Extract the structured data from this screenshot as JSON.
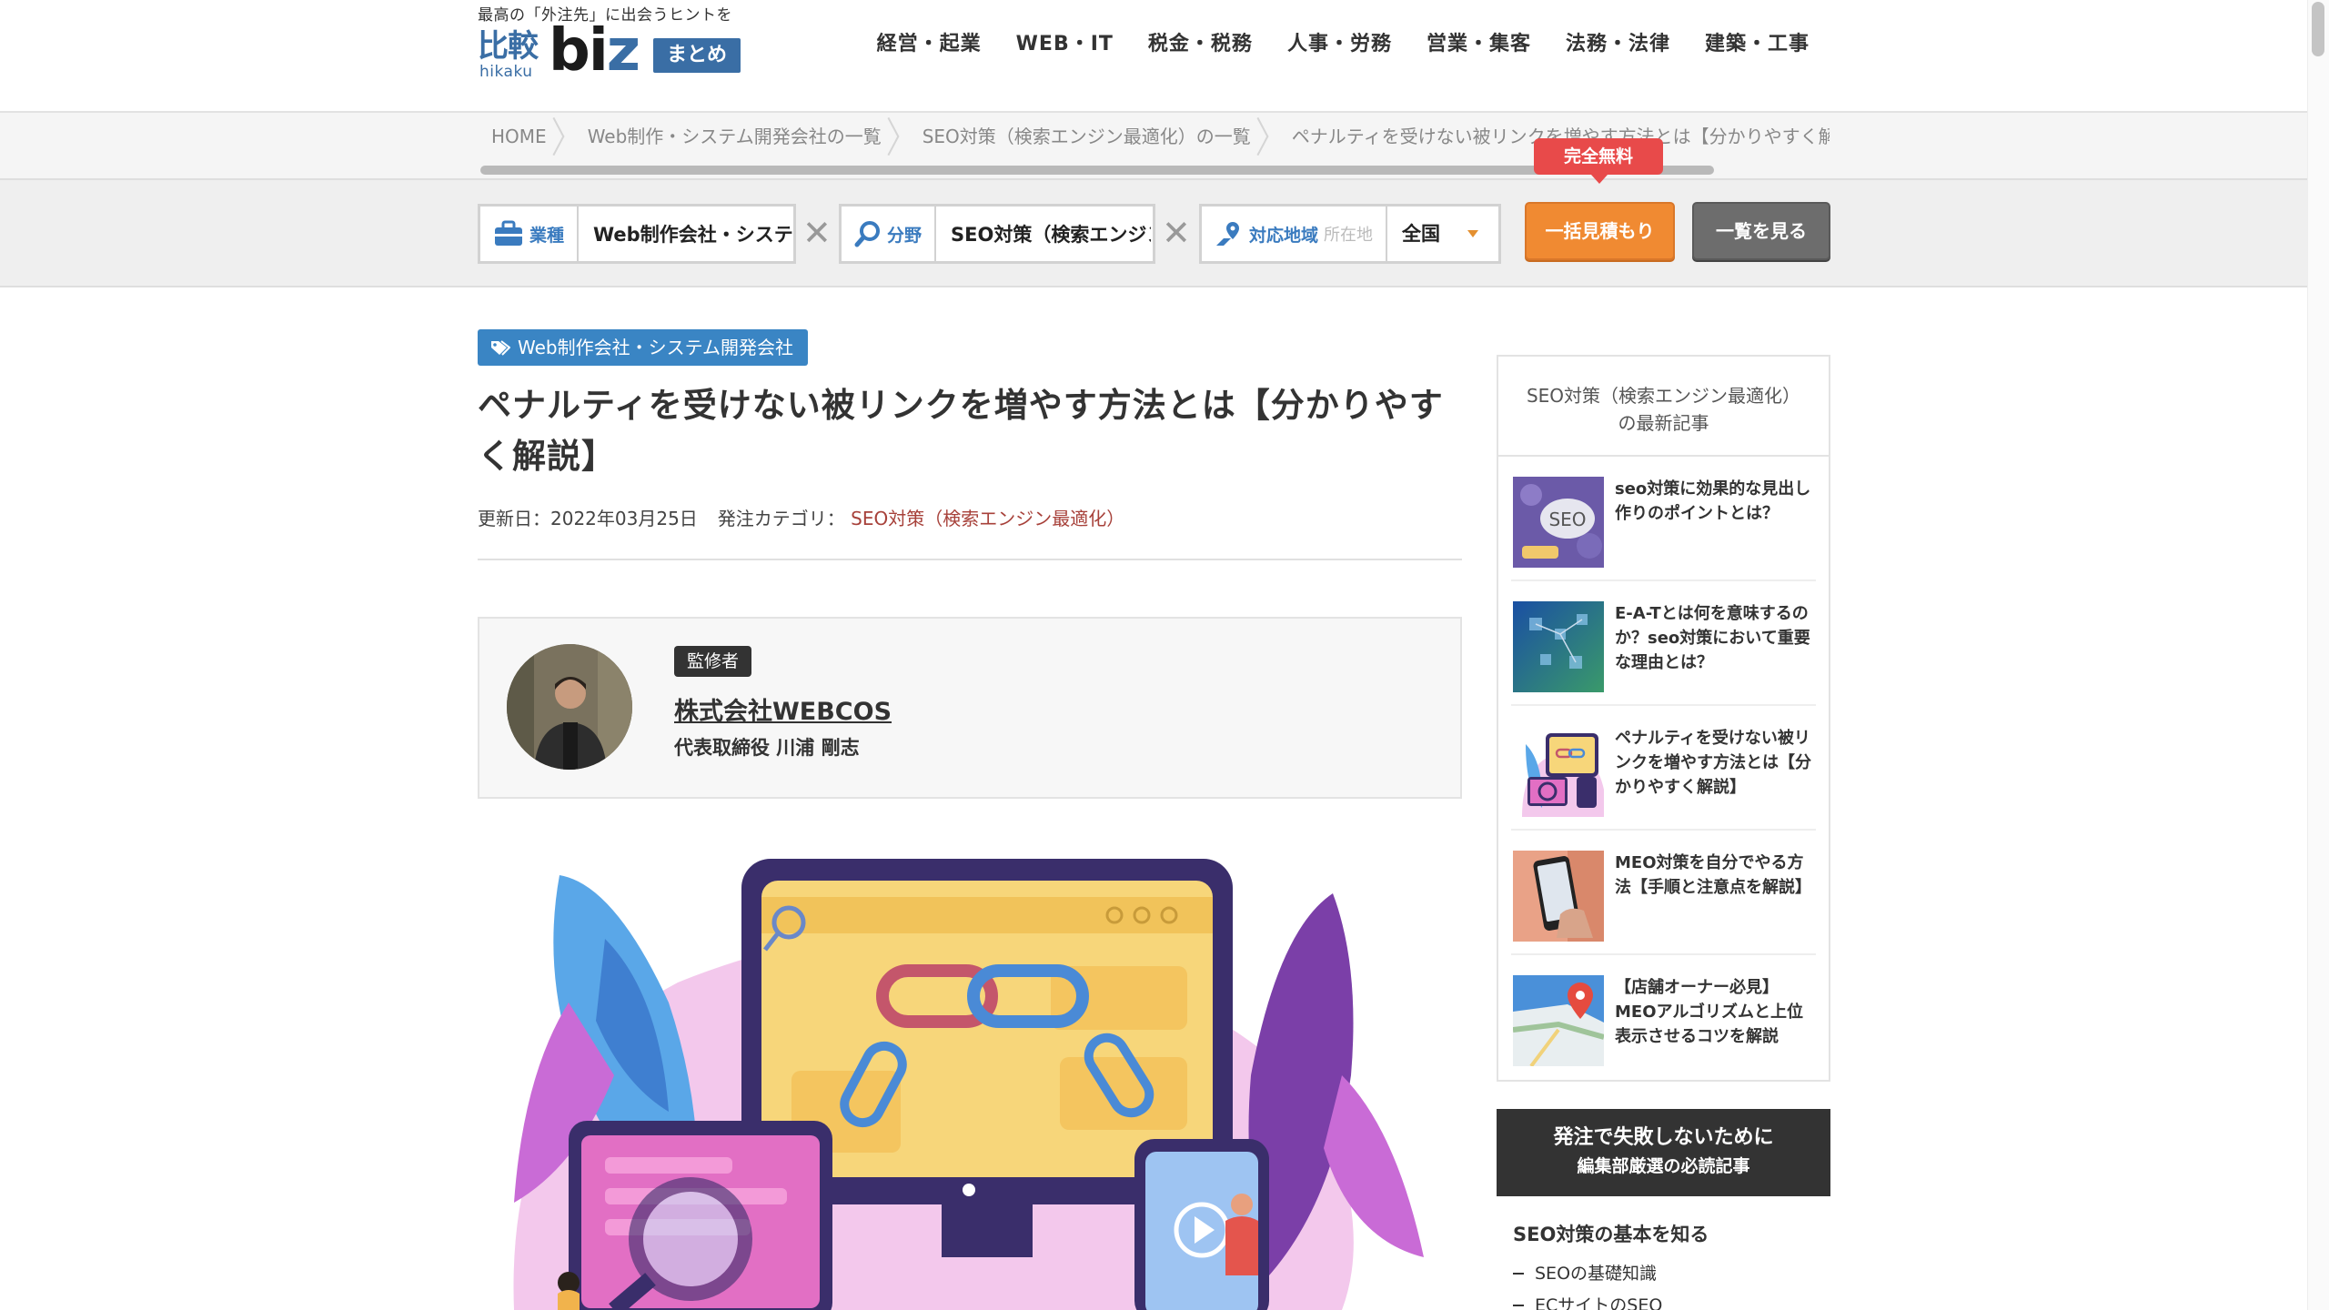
{
  "header": {
    "tagline": "最高の「外注先」に出会うヒントを",
    "logo": {
      "kanji": "比較",
      "roman": "hikaku",
      "biz": "biz",
      "matome": "まとめ"
    },
    "nav": [
      "経営・起業",
      "WEB・IT",
      "税金・税務",
      "人事・労務",
      "営業・集客",
      "法務・法律",
      "建築・工事"
    ]
  },
  "breadcrumb": [
    "HOME",
    "Web制作・システム開発会社の一覧",
    "SEO対策（検索エンジン最適化）の一覧",
    "ペナルティを受けない被リンクを増やす方法とは【分かりやすく解説】"
  ],
  "search": {
    "industry_label": "業種",
    "industry_value": "Web制作会社・システム開発会社",
    "field_label": "分野",
    "field_value": "SEO対策（検索エンジン最適化）",
    "area_label": "対応地域",
    "area_sub": "所在地",
    "area_value": "全国",
    "separator": "✕",
    "free_badge": "完全無料",
    "estimate_button": "一括見積もり",
    "list_button": "一覧を見る"
  },
  "article": {
    "category_tag": "Web制作会社・システム開発会社",
    "title": "ペナルティを受けない被リンクを増やす方法とは【分かりやすく解説】",
    "updated_label": "更新日：",
    "updated_date": "2022年03月25日",
    "order_category_label": "発注カテゴリ：",
    "order_category": "SEO対策（検索エンジン最適化）",
    "supervisor": {
      "badge": "監修者",
      "company": "株式会社WEBCOS",
      "name": "代表取締役 川浦 剛志"
    }
  },
  "sidebar": {
    "latest_heading_1": "SEO対策（検索エンジン最適化）",
    "latest_heading_2": "の最新記事",
    "thumb_seo_text": "SEO",
    "items": [
      "seo対策に効果的な見出し作りのポイントとは？",
      "E-A-Tとは何を意味するのか？seo対策において重要な理由とは？",
      "ペナルティを受けない被リンクを増やす方法とは【分かりやすく解説】",
      "MEO対策を自分でやる方法【手順と注意点を解説】",
      "【店舗オーナー必見】MEOアルゴリズムと上位表示させるコツを解説"
    ],
    "must_read_1": "発注で失敗しないために",
    "must_read_2": "編集部厳選の必読記事",
    "must_read_section": "SEO対策の基本を知る",
    "must_read_links": [
      "SEOの基礎知識",
      "ECサイトのSEO"
    ]
  },
  "colors": {
    "brand_blue": "#3a6ea5",
    "tag_blue": "#3a85c4",
    "orange": "#f08a32",
    "red_badge": "#e84a4a",
    "category_link": "#a7413a"
  }
}
